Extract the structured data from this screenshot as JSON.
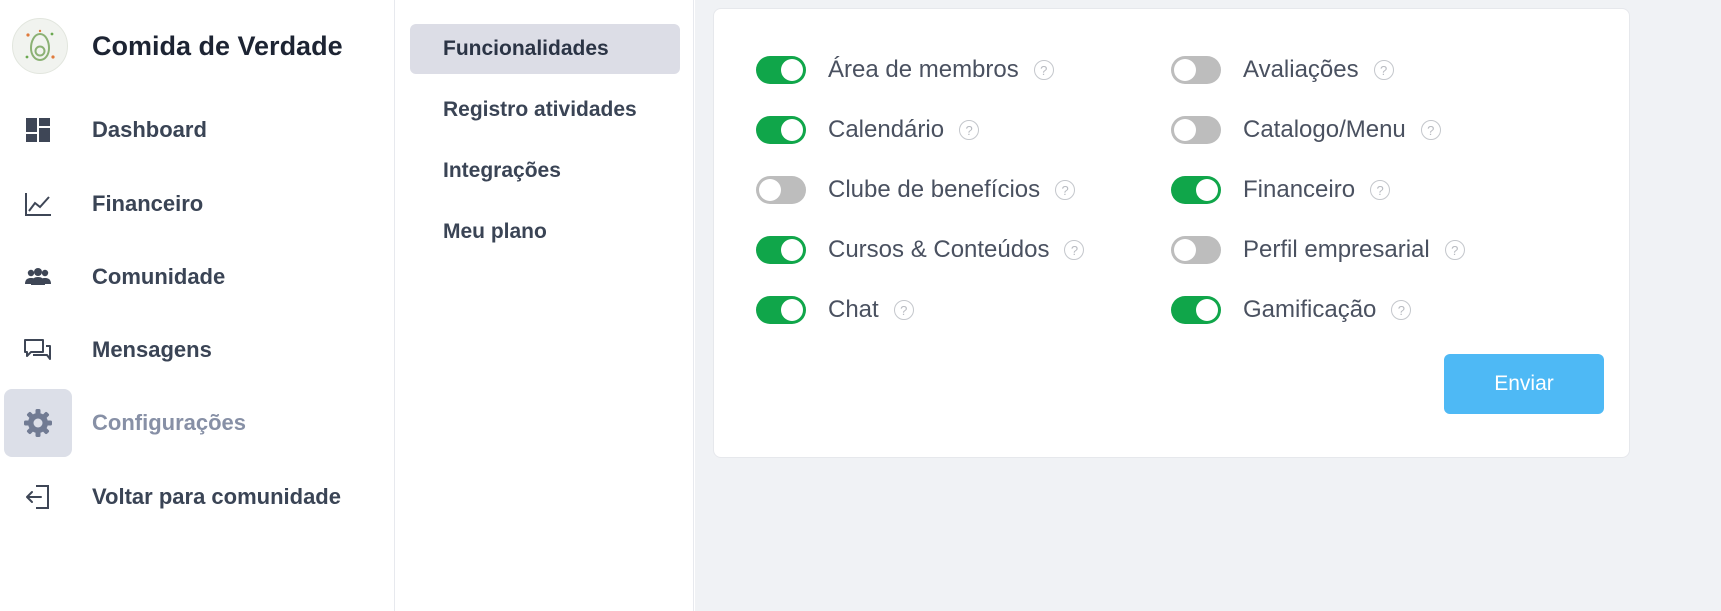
{
  "brand": {
    "name": "Comida de Verdade",
    "logo_icon": "avocado-logo-icon"
  },
  "nav": [
    {
      "label": "Dashboard",
      "icon": "dashboard-icon",
      "active": false
    },
    {
      "label": "Financeiro",
      "icon": "line-chart-icon",
      "active": false
    },
    {
      "label": "Comunidade",
      "icon": "people-icon",
      "active": false
    },
    {
      "label": "Mensagens",
      "icon": "chat-bubbles-icon",
      "active": false
    },
    {
      "label": "Configurações",
      "icon": "gear-icon",
      "active": true
    },
    {
      "label": "Voltar para comunidade",
      "icon": "exit-arrow-icon",
      "active": false
    }
  ],
  "submenu": [
    {
      "label": "Funcionalidades",
      "active": true
    },
    {
      "label": "Registro atividades",
      "active": false
    },
    {
      "label": "Integrações",
      "active": false
    },
    {
      "label": "Meu plano",
      "active": false
    }
  ],
  "features": {
    "left": [
      {
        "label": "Área de membros",
        "enabled": true
      },
      {
        "label": "Calendário",
        "enabled": true
      },
      {
        "label": "Clube de benefícios",
        "enabled": false
      },
      {
        "label": "Cursos & Conteúdos",
        "enabled": true
      },
      {
        "label": "Chat",
        "enabled": true
      }
    ],
    "right": [
      {
        "label": "Avaliações",
        "enabled": false
      },
      {
        "label": "Catalogo/Menu",
        "enabled": false
      },
      {
        "label": "Financeiro",
        "enabled": true
      },
      {
        "label": "Perfil empresarial",
        "enabled": false
      },
      {
        "label": "Gamificação",
        "enabled": true
      }
    ],
    "help_glyph": "?"
  },
  "actions": {
    "send_label": "Enviar"
  },
  "colors": {
    "toggle_on": "#10a64a",
    "toggle_off": "#bdbdbd",
    "send_button": "#4eb9f5",
    "active_nav_bg": "#dcdfe8"
  }
}
